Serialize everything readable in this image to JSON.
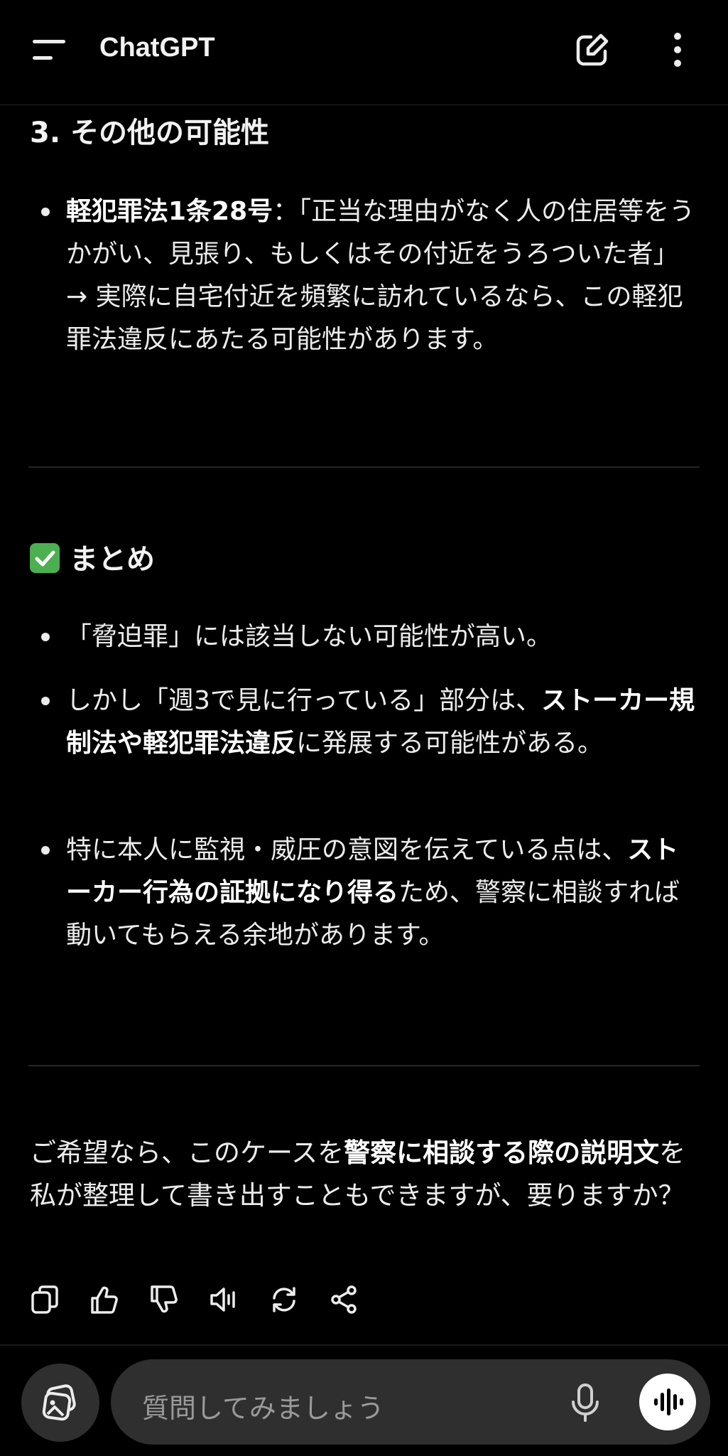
{
  "header": {
    "title": "ChatGPT"
  },
  "section3": {
    "title": "3. その他の可能性",
    "items": [
      {
        "bold": "軽犯罪法1条28号",
        "text": "：「正当な理由がなく人の住居等をうかがい、見張り、もしくはその付近をうろついた者」",
        "text2": "→ 実際に自宅付近を頻繁に訪れているなら、この軽犯罪法違反にあたる可能性があります。"
      }
    ]
  },
  "summary": {
    "title": "まとめ",
    "items": [
      {
        "text": "「脅迫罪」には該当しない可能性が高い。"
      },
      {
        "pre": "しかし「週3で見に行っている」部分は、",
        "bold": "ストーカー規制法や軽犯罪法違反",
        "post": "に発展する可能性がある。"
      },
      {
        "pre": "特に本人に監視・威圧の意図を伝えている点は、",
        "bold": "ストーカー行為の証拠になり得る",
        "post": "ため、警察に相談すれば動いてもらえる余地があります。"
      }
    ]
  },
  "closing": {
    "pre": "ご希望なら、このケースを",
    "bold": "警察に相談する際の説明文",
    "post": "を私が整理して書き出すこともできますが、要りますか？"
  },
  "composer": {
    "placeholder": "質問してみましょう"
  }
}
